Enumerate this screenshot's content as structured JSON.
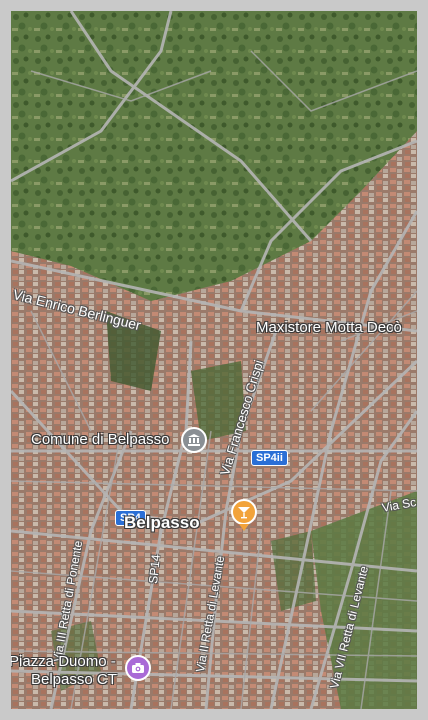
{
  "map": {
    "town_label": "Belpasso",
    "pois": [
      {
        "id": "comune",
        "label": "Comune di Belpasso",
        "icon": "town-hall-icon",
        "color": "#8a8f94"
      },
      {
        "id": "maxistore",
        "label": "Maxistore Motta Decò",
        "icon": "",
        "color": ""
      },
      {
        "id": "bar",
        "label": "",
        "icon": "cocktail-icon",
        "color": "#f2a33a"
      },
      {
        "id": "piazza",
        "label": "Piazza Duomo - Belpasso CT",
        "label_line1": "Piazza Duomo -",
        "label_line2": "Belpasso CT",
        "icon": "camera-icon",
        "color": "#a96ad6"
      }
    ],
    "streets": [
      {
        "id": "berlinguer",
        "label": "Via Enrico Berlinguer"
      },
      {
        "id": "crispi",
        "label": "Via Francesco Crispi"
      },
      {
        "id": "iii-retta-ponente",
        "label": "Via III Retta di Ponente"
      },
      {
        "id": "sp14",
        "label": "SP14"
      },
      {
        "id": "ii-retta-levante",
        "label": "Via II Retta di Levante"
      },
      {
        "id": "vii-retta-levante",
        "label": "Via VII Retta di Levante"
      },
      {
        "id": "via-sc",
        "label": "Via Sc"
      }
    ],
    "shields": [
      {
        "id": "sp4ii",
        "label": "SP4ii",
        "color": "#2a6fd6"
      },
      {
        "id": "sp4",
        "label": "SP4",
        "color": "#2a6fd6"
      }
    ]
  }
}
